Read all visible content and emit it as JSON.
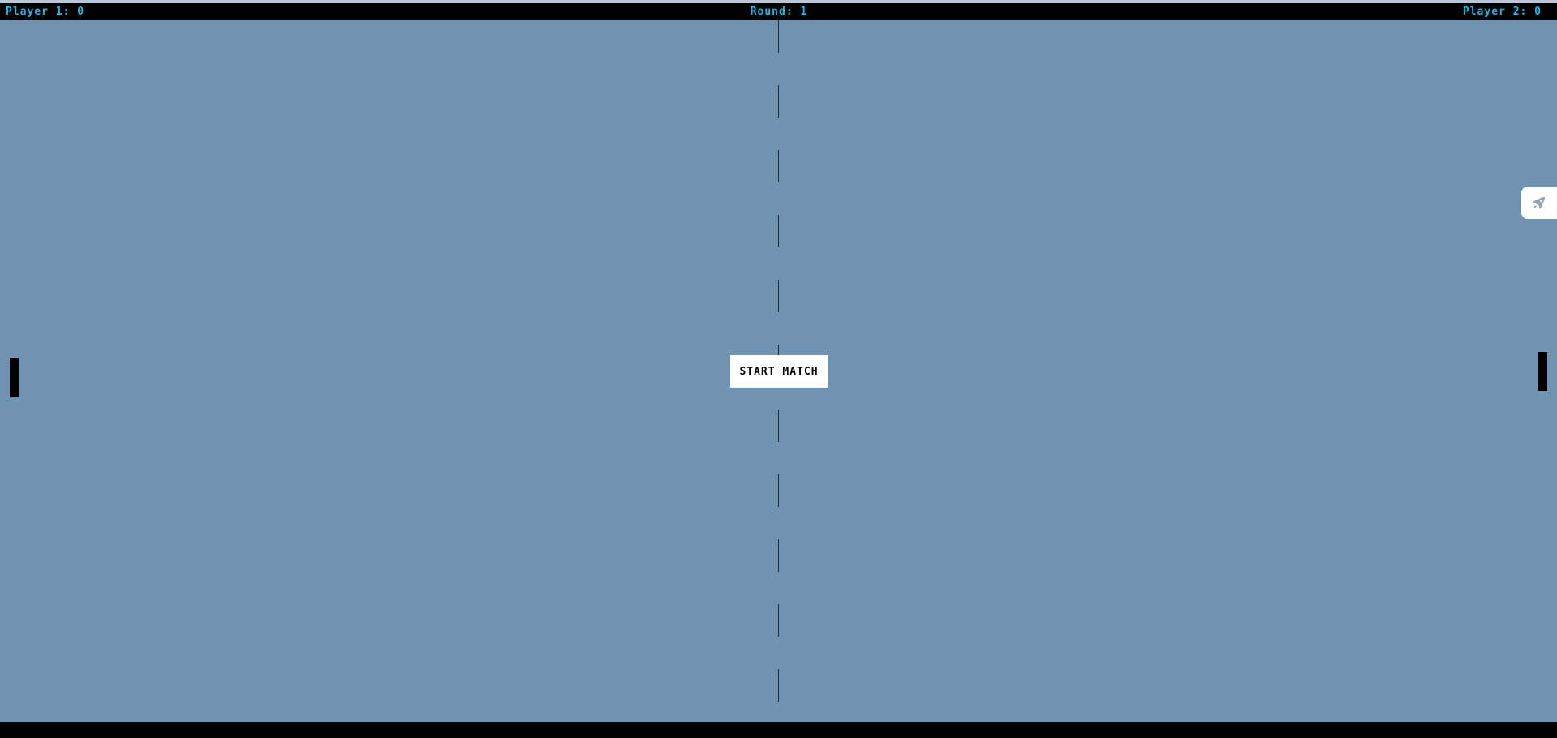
{
  "scoreboard": {
    "player1": "Player 1: 0",
    "round": "Round: 1",
    "player2": "Player 2: 0"
  },
  "controls": {
    "start_label": "START MATCH"
  },
  "side_tab": {
    "icon": "rocket-icon"
  },
  "colors": {
    "field": "#7193b2",
    "bars": "#000000",
    "score_text": "#1fb8e8",
    "center_line": "#1e2b38",
    "button_bg": "#ffffff"
  }
}
